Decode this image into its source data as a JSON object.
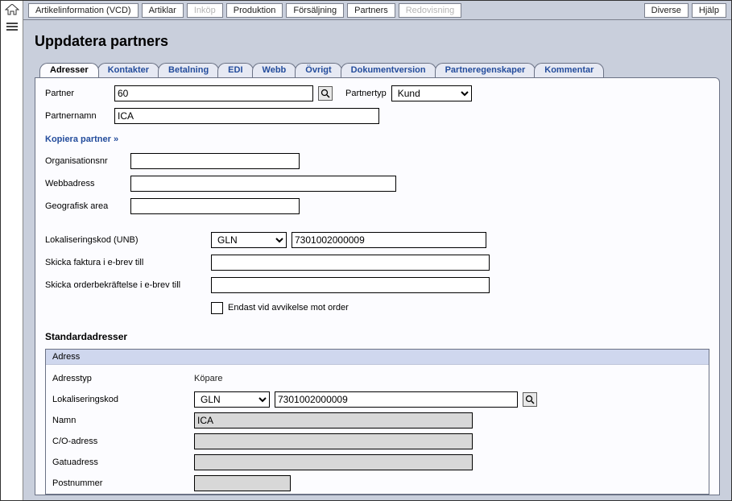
{
  "topnav": {
    "items": [
      {
        "label": "Artikelinformation (VCD)",
        "disabled": false
      },
      {
        "label": "Artiklar",
        "disabled": false
      },
      {
        "label": "Inköp",
        "disabled": true
      },
      {
        "label": "Produktion",
        "disabled": false
      },
      {
        "label": "Försäljning",
        "disabled": false
      },
      {
        "label": "Partners",
        "disabled": false
      },
      {
        "label": "Redovisning",
        "disabled": true
      },
      {
        "label": "Diverse",
        "disabled": false
      },
      {
        "label": "Hjälp",
        "disabled": false
      }
    ]
  },
  "page_title": "Uppdatera partners",
  "tabs": [
    {
      "label": "Adresser",
      "active": true
    },
    {
      "label": "Kontakter",
      "active": false
    },
    {
      "label": "Betalning",
      "active": false
    },
    {
      "label": "EDI",
      "active": false
    },
    {
      "label": "Webb",
      "active": false
    },
    {
      "label": "Övrigt",
      "active": false
    },
    {
      "label": "Dokumentversion",
      "active": false
    },
    {
      "label": "Partneregenskaper",
      "active": false
    },
    {
      "label": "Kommentar",
      "active": false
    }
  ],
  "form": {
    "partner_label": "Partner",
    "partner_value": "60",
    "partnertyp_label": "Partnertyp",
    "partnertyp_value": "Kund",
    "partnernamn_label": "Partnernamn",
    "partnernamn_value": "ICA",
    "copy_partner_link": "Kopiera partner »",
    "orgnr_label": "Organisationsnr",
    "orgnr_value": "",
    "web_label": "Webbadress",
    "web_value": "",
    "geo_label": "Geografisk area",
    "geo_value": "",
    "unb_label": "Lokaliseringskod (UNB)",
    "unb_select": "GLN",
    "unb_value": "7301002000009",
    "einv_label": "Skicka faktura i e-brev till",
    "einv_value": "",
    "eorder_label": "Skicka orderbekräftelse i e-brev till",
    "eorder_value": "",
    "deviation_checkbox_label": "Endast vid avvikelse mot order"
  },
  "std_addresses": {
    "section_title": "Standardadresser",
    "header": "Adress",
    "rows": {
      "adresstyp_label": "Adresstyp",
      "adresstyp_value": "Köpare",
      "loc_label": "Lokaliseringskod",
      "loc_select": "GLN",
      "loc_value": "7301002000009",
      "namn_label": "Namn",
      "namn_value": "ICA",
      "co_label": "C/O-adress",
      "co_value": "",
      "gata_label": "Gatuadress",
      "gata_value": "",
      "postnr_label": "Postnummer",
      "postnr_value": ""
    }
  }
}
